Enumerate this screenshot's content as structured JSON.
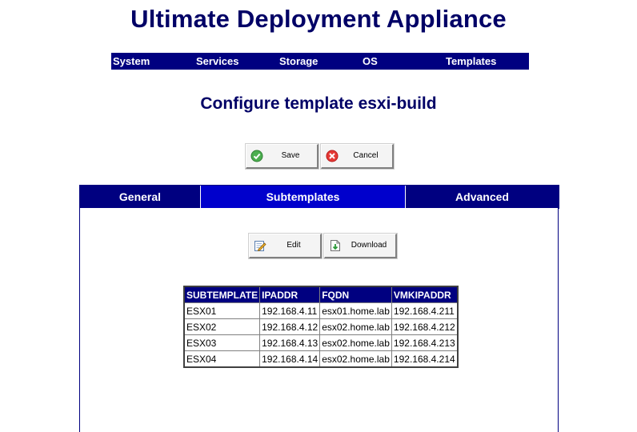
{
  "app": {
    "title": "Ultimate Deployment Appliance"
  },
  "nav": {
    "items": [
      {
        "label": "System"
      },
      {
        "label": "Services"
      },
      {
        "label": "Storage"
      },
      {
        "label": "OS"
      },
      {
        "label": "Templates"
      }
    ]
  },
  "page": {
    "title": "Configure template esxi-build"
  },
  "toolbar": {
    "save_label": "Save",
    "cancel_label": "Cancel"
  },
  "tabs": [
    {
      "label": "General"
    },
    {
      "label": "Subtemplates",
      "active": true
    },
    {
      "label": "Advanced"
    }
  ],
  "subtoolbar": {
    "edit_label": "Edit",
    "download_label": "Download"
  },
  "table": {
    "headers": [
      "SUBTEMPLATE",
      "IPADDR",
      "FQDN",
      "VMKIPADDR"
    ],
    "rows": [
      [
        "ESX01",
        "192.168.4.11",
        "esx01.home.lab",
        "192.168.4.211"
      ],
      [
        "ESX02",
        "192.168.4.12",
        "esx02.home.lab",
        "192.168.4.212"
      ],
      [
        "ESX03",
        "192.168.4.13",
        "esx02.home.lab",
        "192.168.4.213"
      ],
      [
        "ESX04",
        "192.168.4.14",
        "esx02.home.lab",
        "192.168.4.214"
      ]
    ]
  },
  "colors": {
    "navy": "#000080",
    "title": "#000066",
    "active_tab": "#0000cc"
  }
}
